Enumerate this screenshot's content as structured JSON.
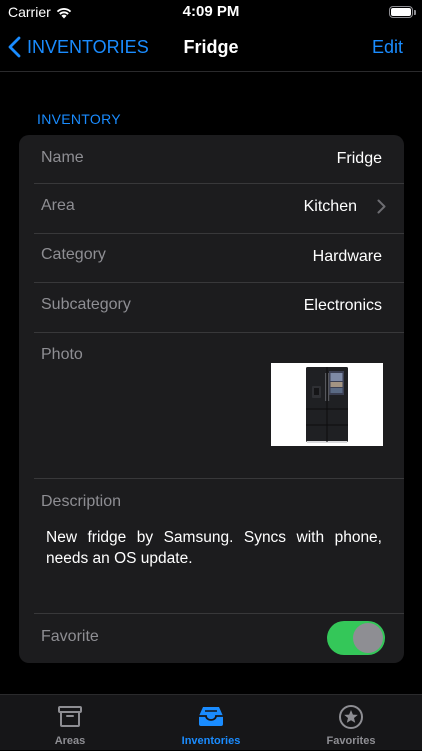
{
  "status_bar": {
    "carrier": "Carrier",
    "time": "4:09 PM",
    "icons": [
      "wifi-icon",
      "battery-icon"
    ]
  },
  "nav": {
    "back_label": "INVENTORIES",
    "title": "Fridge",
    "edit_label": "Edit"
  },
  "section": {
    "header": "INVENTORY"
  },
  "fields": {
    "name": {
      "label": "Name",
      "value": "Fridge"
    },
    "area": {
      "label": "Area",
      "value": "Kitchen"
    },
    "category": {
      "label": "Category",
      "value": "Hardware"
    },
    "subcategory": {
      "label": "Subcategory",
      "value": "Electronics"
    },
    "photo": {
      "label": "Photo"
    },
    "description": {
      "label": "Description",
      "value": "New fridge by Samsung. Syncs with phone, needs an OS update."
    },
    "favorite": {
      "label": "Favorite",
      "on": true
    }
  },
  "tabs": [
    {
      "label": "Areas",
      "icon": "archive-box-icon",
      "active": false
    },
    {
      "label": "Inventories",
      "icon": "tray-icon",
      "active": true
    },
    {
      "label": "Favorites",
      "icon": "star-circle-icon",
      "active": false
    }
  ],
  "colors": {
    "accent": "#1a8cff",
    "toggle_on": "#34c759",
    "background": "#000000",
    "card": "#1c1c1e"
  }
}
